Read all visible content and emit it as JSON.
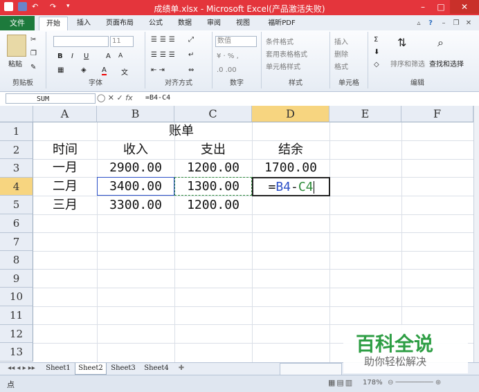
{
  "window": {
    "title": "成绩单.xlsx - Microsoft Excel(产品激活失败)",
    "min_label": "–",
    "max_label": "□",
    "close_label": "✕"
  },
  "ribbon_tabs": {
    "file": "文件",
    "tabs": [
      "开始",
      "插入",
      "页面布局",
      "公式",
      "数据",
      "审阅",
      "视图",
      "福昕PDF"
    ]
  },
  "ribbon": {
    "groups": [
      "剪贴板",
      "字体",
      "对齐方式",
      "数字",
      "样式",
      "单元格",
      "编辑"
    ],
    "paste_label": "粘贴",
    "font_size": "11",
    "number_format": "数值",
    "styles": [
      "条件格式",
      "套用表格格式",
      "单元格样式"
    ],
    "cells": [
      "插入",
      "删除",
      "格式"
    ],
    "editing": [
      "排序和筛选",
      "查找和选择"
    ]
  },
  "formula_bar": {
    "name_box": "SUM",
    "formula": "=B4-C4"
  },
  "columns": [
    "A",
    "B",
    "C",
    "D",
    "E",
    "F"
  ],
  "rows": [
    "1",
    "2",
    "3",
    "4",
    "5",
    "6",
    "7",
    "8",
    "9",
    "10",
    "11",
    "12",
    "13"
  ],
  "sheet": {
    "title": "账单",
    "headers": [
      "时间",
      "收入",
      "支出",
      "结余"
    ],
    "rows": [
      {
        "month": "一月",
        "income": "2900.00",
        "expense": "1200.00",
        "balance": "1700.00"
      },
      {
        "month": "二月",
        "income": "3400.00",
        "expense": "1300.00",
        "balance": ""
      },
      {
        "month": "三月",
        "income": "3300.00",
        "expense": "1200.00",
        "balance": ""
      }
    ],
    "editing_parts": {
      "eq": "=",
      "ref1": "B4",
      "op": "-",
      "ref2": "C4"
    }
  },
  "sheet_tabs": [
    "Sheet1",
    "Sheet2",
    "Sheet3",
    "Sheet4"
  ],
  "status": {
    "mode": "点",
    "zoom": "178%"
  },
  "watermark": {
    "title": "百科全说",
    "subtitle": "助你轻松解决"
  },
  "colors": {
    "title_bar": "#e4353c",
    "file_tab": "#1d7a3c",
    "ref1_color": "#2b4fc7",
    "ref2_color": "#2e8b3a",
    "watermark_green": "#2e9e44"
  }
}
